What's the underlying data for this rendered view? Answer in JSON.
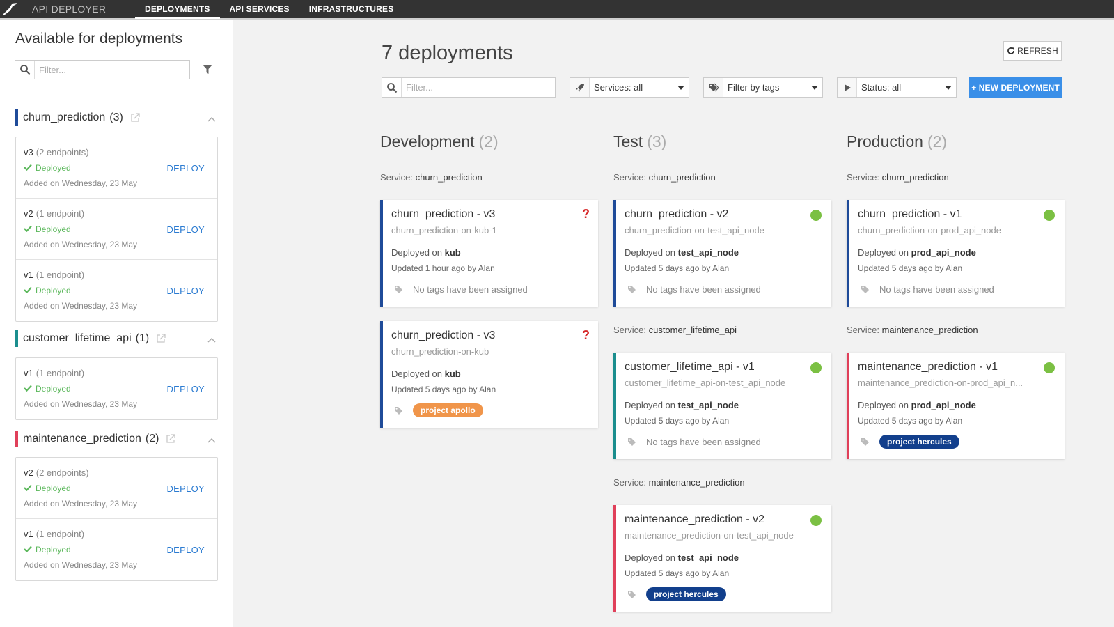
{
  "topbar": {
    "app_title": "API DEPLOYER",
    "tabs": [
      {
        "label": "DEPLOYMENTS",
        "active": true
      },
      {
        "label": "API SERVICES",
        "active": false
      },
      {
        "label": "INFRASTRUCTURES",
        "active": false
      }
    ]
  },
  "sidebar": {
    "title": "Available for deployments",
    "search_placeholder": "Filter...",
    "services": [
      {
        "name": "churn_prediction",
        "count": "(3)",
        "color": "#1f4b99",
        "versions": [
          {
            "version": "v3",
            "endpoints": "(2 endpoints)",
            "status": "Deployed",
            "added": "Added on Wednesday, 23 May",
            "action": "DEPLOY"
          },
          {
            "version": "v2",
            "endpoints": "(1 endpoint)",
            "status": "Deployed",
            "added": "Added on Wednesday, 23 May",
            "action": "DEPLOY"
          },
          {
            "version": "v1",
            "endpoints": "(1 endpoint)",
            "status": "Deployed",
            "added": "Added on Wednesday, 23 May",
            "action": "DEPLOY"
          }
        ]
      },
      {
        "name": "customer_lifetime_api",
        "count": "(1)",
        "color": "#1b8e8e",
        "versions": [
          {
            "version": "v1",
            "endpoints": "(1 endpoint)",
            "status": "Deployed",
            "added": "Added on Wednesday, 23 May",
            "action": "DEPLOY"
          }
        ]
      },
      {
        "name": "maintenance_prediction",
        "count": "(2)",
        "color": "#e0405a",
        "versions": [
          {
            "version": "v2",
            "endpoints": "(2 endpoints)",
            "status": "Deployed",
            "added": "Added on Wednesday, 23 May",
            "action": "DEPLOY"
          },
          {
            "version": "v1",
            "endpoints": "(1 endpoint)",
            "status": "Deployed",
            "added": "Added on Wednesday, 23 May",
            "action": "DEPLOY"
          }
        ]
      }
    ]
  },
  "main": {
    "title": "7 deployments",
    "refresh_label": "REFRESH",
    "search_placeholder": "Filter...",
    "services_filter": "Services: all",
    "tags_filter": "Filter by tags",
    "status_filter": "Status: all",
    "new_deployment_label": "+ NEW DEPLOYMENT",
    "service_prefix": "Service:",
    "deployed_prefix": "Deployed on",
    "columns": [
      {
        "title": "Development",
        "count": "(2)",
        "groups": [
          {
            "service": "churn_prediction",
            "cards": [
              {
                "title": "churn_prediction - v3",
                "subtitle": "churn_prediction-on-kub-1",
                "infra": "kub",
                "updated": "Updated 1 hour ago by Alan",
                "status": "unknown",
                "color": "#1f4b99",
                "tag_text": "No tags have been assigned",
                "tag": null
              },
              {
                "title": "churn_prediction - v3",
                "subtitle": "churn_prediction-on-kub",
                "infra": "kub",
                "updated": "Updated 5 days ago by Alan",
                "status": "unknown",
                "color": "#1f4b99",
                "tag_text": null,
                "tag": {
                  "label": "project apollo",
                  "color": "#f0954a"
                }
              }
            ]
          }
        ]
      },
      {
        "title": "Test",
        "count": "(3)",
        "groups": [
          {
            "service": "churn_prediction",
            "cards": [
              {
                "title": "churn_prediction - v2",
                "subtitle": "churn_prediction-on-test_api_node",
                "infra": "test_api_node",
                "updated": "Updated 5 days ago by Alan",
                "status": "ok",
                "color": "#1f4b99",
                "tag_text": "No tags have been assigned",
                "tag": null
              }
            ]
          },
          {
            "service": "customer_lifetime_api",
            "cards": [
              {
                "title": "customer_lifetime_api - v1",
                "subtitle": "customer_lifetime_api-on-test_api_node",
                "infra": "test_api_node",
                "updated": "Updated 5 days ago by Alan",
                "status": "ok",
                "color": "#1b8e8e",
                "tag_text": "No tags have been assigned",
                "tag": null
              }
            ]
          },
          {
            "service": "maintenance_prediction",
            "cards": [
              {
                "title": "maintenance_prediction - v2",
                "subtitle": "maintenance_prediction-on-test_api_node",
                "infra": "test_api_node",
                "updated": "Updated 5 days ago by Alan",
                "status": "ok",
                "color": "#e0405a",
                "tag_text": null,
                "tag": {
                  "label": "project hercules",
                  "color": "#123f8c"
                }
              }
            ]
          }
        ]
      },
      {
        "title": "Production",
        "count": "(2)",
        "groups": [
          {
            "service": "churn_prediction",
            "cards": [
              {
                "title": "churn_prediction - v1",
                "subtitle": "churn_prediction-on-prod_api_node",
                "infra": "prod_api_node",
                "updated": "Updated 5 days ago by Alan",
                "status": "ok",
                "color": "#1f4b99",
                "tag_text": "No tags have been assigned",
                "tag": null
              }
            ]
          },
          {
            "service": "maintenance_prediction",
            "cards": [
              {
                "title": "maintenance_prediction - v1",
                "subtitle": "maintenance_prediction-on-prod_api_n...",
                "infra": "prod_api_node",
                "updated": "Updated 5 days ago by Alan",
                "status": "ok",
                "color": "#e0405a",
                "tag_text": null,
                "tag": {
                  "label": "project hercules",
                  "color": "#123f8c"
                }
              }
            ]
          }
        ]
      }
    ]
  }
}
